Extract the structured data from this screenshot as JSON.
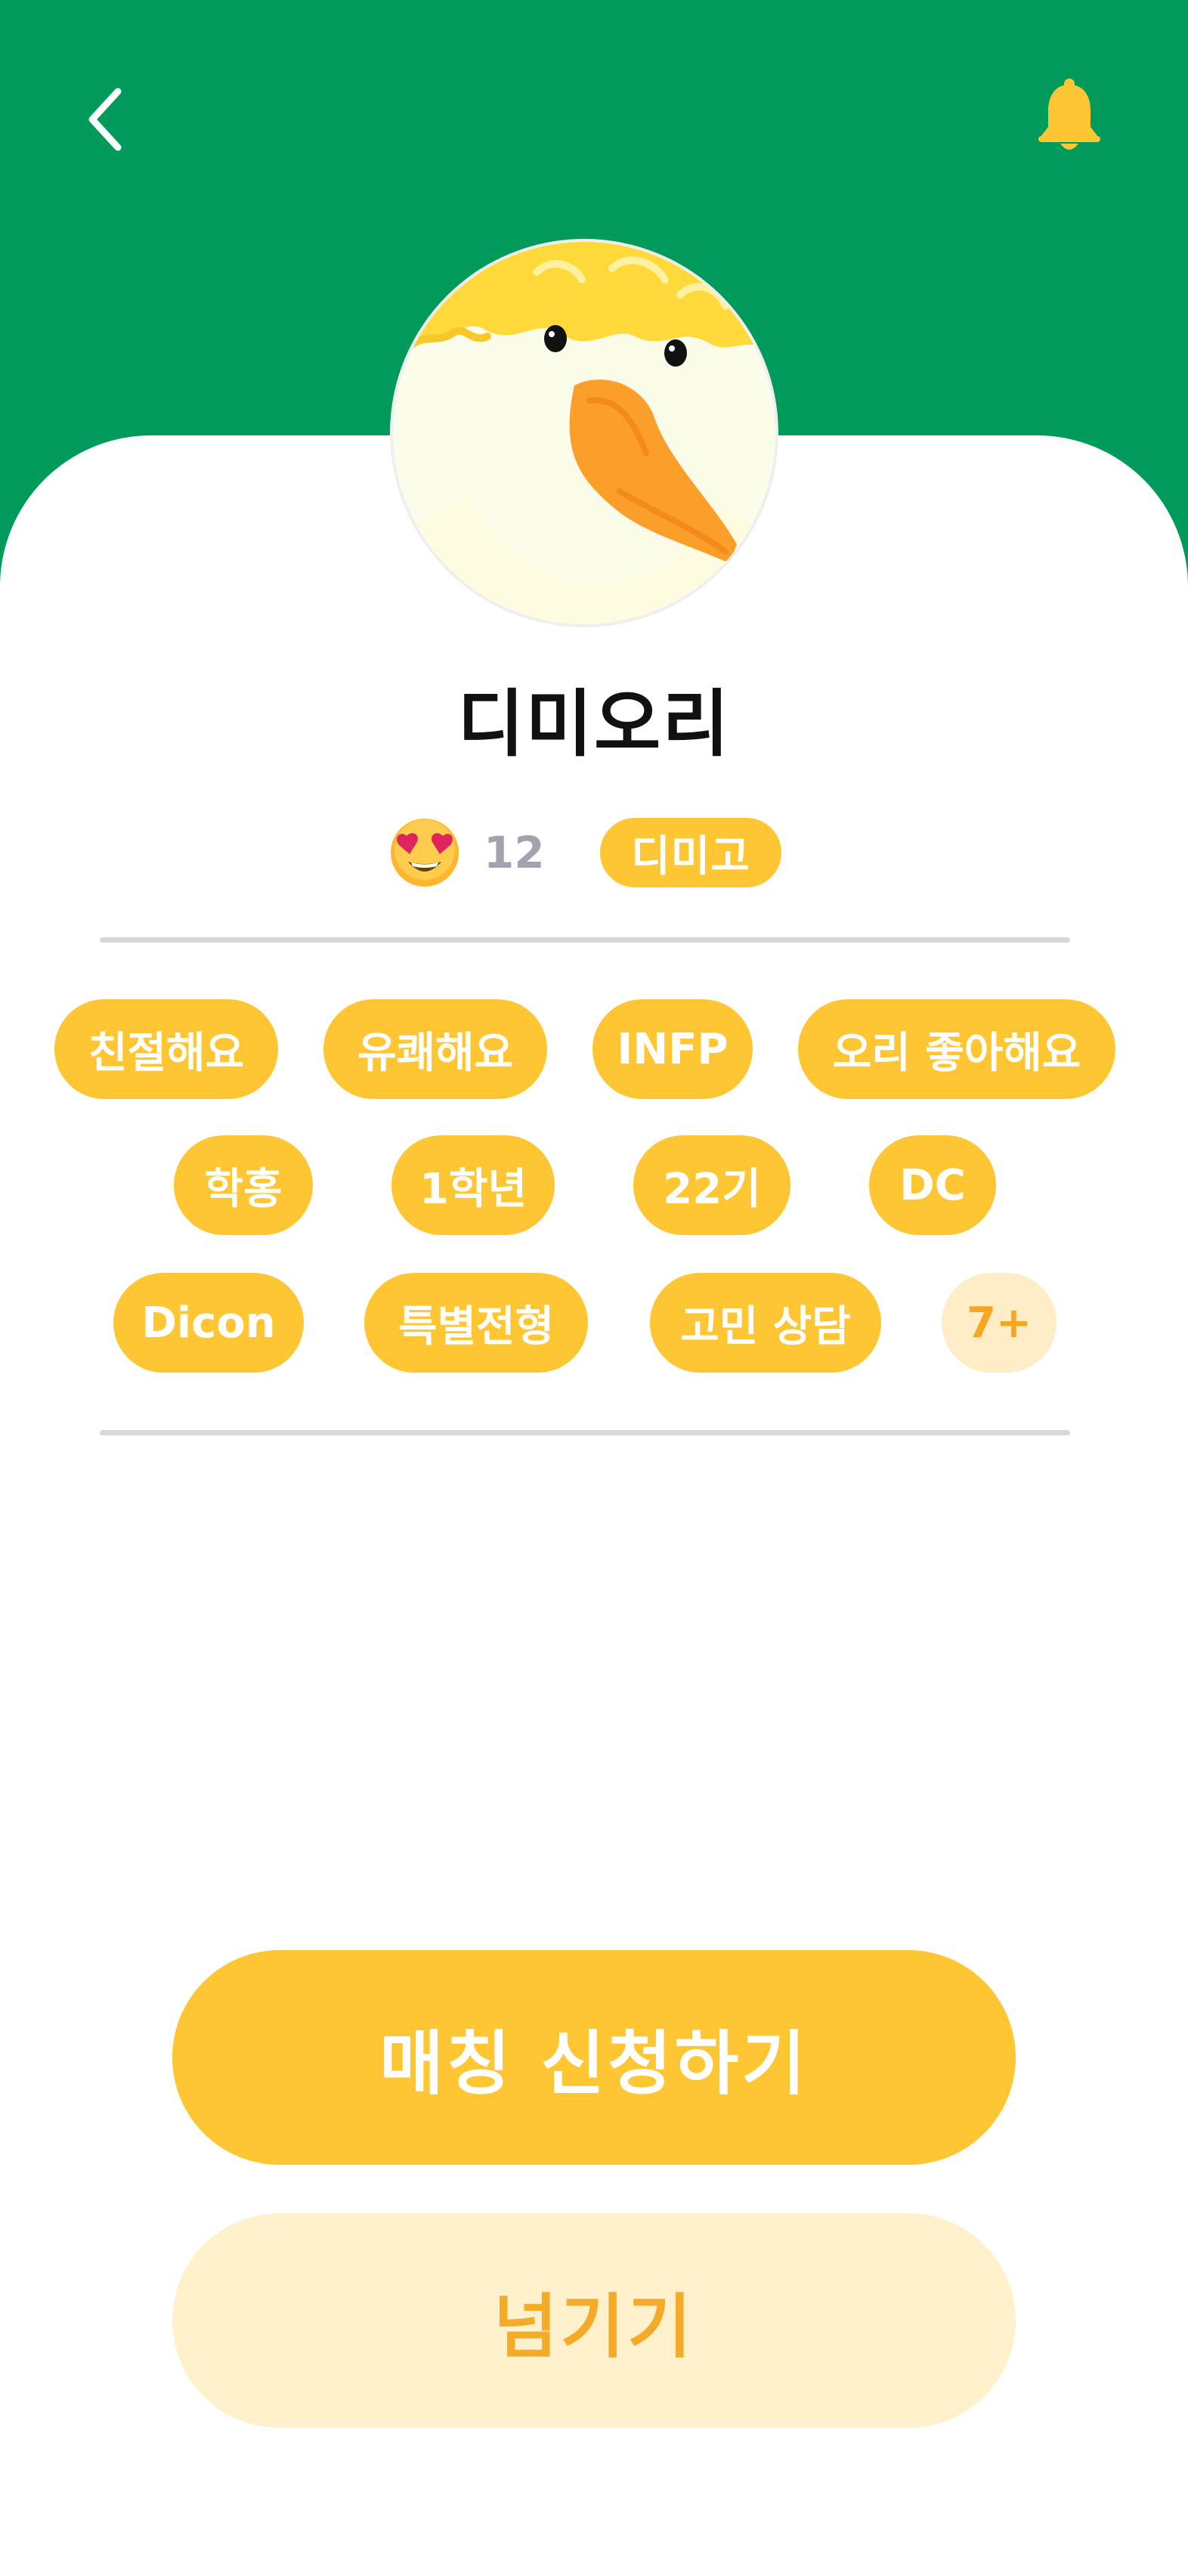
{
  "header": {
    "back_icon": "chevron-left-icon",
    "bell_icon": "bell-icon",
    "colors": {
      "background": "#009A5B",
      "bell": "#FFC634"
    }
  },
  "profile": {
    "name": "디미오리",
    "avatar": "duck-avatar",
    "reaction_icon": "heart-eyes-emoji-icon",
    "like_count": "12",
    "school": "디미고"
  },
  "tags": [
    {
      "label": "친절해요"
    },
    {
      "label": "유쾌해요"
    },
    {
      "label": "INFP"
    },
    {
      "label": "오리 좋아해요"
    },
    {
      "label": "학홍"
    },
    {
      "label": "1학년"
    },
    {
      "label": "22기"
    },
    {
      "label": "DC"
    },
    {
      "label": "Dicon"
    },
    {
      "label": "특별전형"
    },
    {
      "label": "고민 상담"
    }
  ],
  "tags_more": "7+",
  "actions": {
    "primary": "매칭 신청하기",
    "secondary": "넘기기"
  },
  "colors": {
    "accent": "#FFC634",
    "accent_light": "#FFF1CB",
    "muted_text": "#A2A3B1",
    "divider": "#D8D8DA"
  }
}
